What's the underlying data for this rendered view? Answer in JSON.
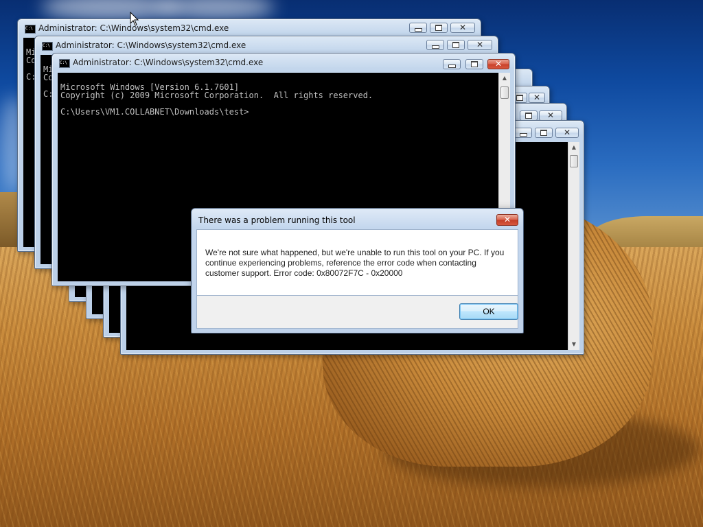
{
  "desktop": {
    "wallpaper": "hay-bale-field"
  },
  "cmd_windows": [
    {
      "title": "Administrator: C:\\Windows\\system32\\cmd.exe",
      "console_lines": [
        "Mic",
        "Co",
        "",
        "C:"
      ]
    },
    {
      "title": "Administrator: C:\\Windows\\system32\\cmd.exe",
      "console_lines": [
        "Mi",
        "Co",
        "",
        "C:"
      ]
    },
    {
      "title": "Administrator: C:\\Windows\\system32\\cmd.exe",
      "console_lines": [
        "Microsoft Windows [Version 6.1.7601]",
        "Copyright (c) 2009 Microsoft Corporation.  All rights reserved.",
        "",
        "C:\\Users\\VM1.COLLABNET\\Downloads\\test>"
      ]
    }
  ],
  "window_controls": {
    "minimize_icon": "minimize-icon",
    "maximize_icon": "maximize-icon",
    "close_icon": "close-icon",
    "close_glyph": "✕"
  },
  "dialog": {
    "title": "There was a problem running this tool",
    "message": "We're not sure what happened, but we're unable to run this tool on your PC. If you continue experiencing problems, reference the error code when contacting customer support. Error code: 0x80072F7C - 0x20000",
    "ok_label": "OK",
    "close_glyph": "✕"
  },
  "colors": {
    "console_bg": "#000000",
    "console_text": "#c0c0c0",
    "close_button_red": "#d9604a",
    "ok_button_border": "#3c7fb1"
  }
}
